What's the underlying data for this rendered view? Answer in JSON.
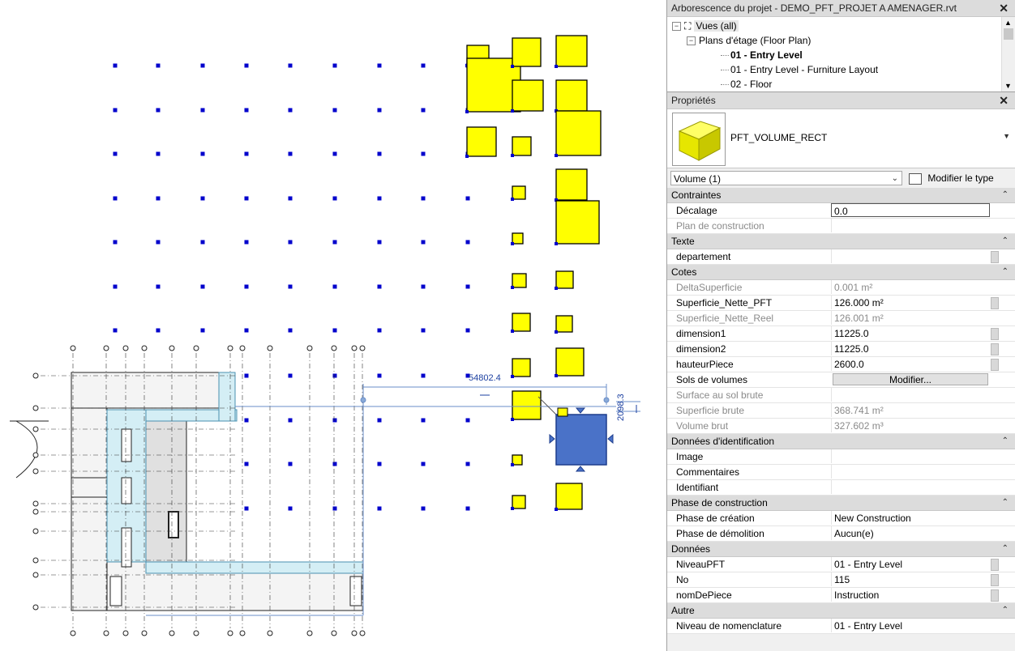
{
  "canvas": {
    "dimension_label": "54802.4",
    "dimension_label_vertical": "2098.3"
  },
  "browser": {
    "title": "Arborescence du projet - DEMO_PFT_PROJET A AMENAGER.rvt",
    "items": [
      {
        "label": "Vues (all)",
        "toggle": "−",
        "icon": "views-icon"
      },
      {
        "label": "Plans d'étage (Floor Plan)",
        "toggle": "−"
      },
      {
        "label": "01 - Entry Level",
        "bold": true
      },
      {
        "label": "01 - Entry Level - Furniture Layout"
      },
      {
        "label": "02 - Floor"
      }
    ]
  },
  "properties": {
    "title": "Propriétés",
    "type_name": "PFT_VOLUME_RECT",
    "filter": "Volume (1)",
    "edit_type": "Modifier le type",
    "groups": [
      {
        "name": "Contraintes",
        "rows": [
          {
            "k": "Décalage",
            "v": "0.0",
            "edit": true
          },
          {
            "k": "Plan de construction",
            "v": "",
            "dis": true
          }
        ]
      },
      {
        "name": "Texte",
        "rows": [
          {
            "k": "departement",
            "v": "",
            "sb": true
          }
        ]
      },
      {
        "name": "Cotes",
        "rows": [
          {
            "k": "DeltaSuperficie",
            "v": "0.001 m²",
            "dis": true
          },
          {
            "k": "Superficie_Nette_PFT",
            "v": "126.000 m²",
            "sb": true
          },
          {
            "k": "Superficie_Nette_Reel",
            "v": "126.001 m²",
            "dis": true
          },
          {
            "k": "dimension1",
            "v": "11225.0",
            "sb": true
          },
          {
            "k": "dimension2",
            "v": "11225.0",
            "sb": true
          },
          {
            "k": "hauteurPiece",
            "v": "2600.0",
            "sb": true
          },
          {
            "k": "Sols de volumes",
            "v": "Modifier...",
            "btn": true
          },
          {
            "k": "Surface au sol brute",
            "v": "",
            "dis": true
          },
          {
            "k": "Superficie brute",
            "v": "368.741 m²",
            "dis": true
          },
          {
            "k": "Volume brut",
            "v": "327.602 m³",
            "dis": true
          }
        ]
      },
      {
        "name": "Données d'identification",
        "rows": [
          {
            "k": "Image",
            "v": ""
          },
          {
            "k": "Commentaires",
            "v": ""
          },
          {
            "k": "Identifiant",
            "v": ""
          }
        ]
      },
      {
        "name": "Phase de construction",
        "rows": [
          {
            "k": "Phase de création",
            "v": "New Construction"
          },
          {
            "k": "Phase de démolition",
            "v": "Aucun(e)"
          }
        ]
      },
      {
        "name": "Données",
        "rows": [
          {
            "k": "NiveauPFT",
            "v": "01 - Entry Level",
            "sb": true
          },
          {
            "k": "No",
            "v": "115",
            "sb": true
          },
          {
            "k": "nomDePiece",
            "v": "Instruction",
            "sb": true
          }
        ]
      },
      {
        "name": "Autre",
        "rows": [
          {
            "k": "Niveau de nomenclature",
            "v": "01 - Entry Level"
          }
        ]
      }
    ]
  },
  "colors": {
    "volume_fill": "#ffff00",
    "selected_fill": "#4a72c8",
    "grid_dot": "#0000cc",
    "room_fill": "#d4eef5"
  }
}
